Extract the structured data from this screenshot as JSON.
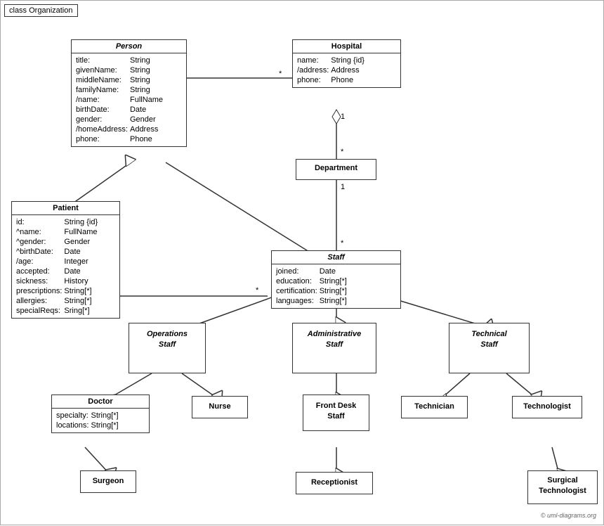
{
  "diagram": {
    "title": "class Organization",
    "copyright": "© uml-diagrams.org",
    "classes": {
      "person": {
        "name": "Person",
        "italic": true,
        "attrs": [
          {
            "name": "title:",
            "type": "String"
          },
          {
            "name": "givenName:",
            "type": "String"
          },
          {
            "name": "middleName:",
            "type": "String"
          },
          {
            "name": "familyName:",
            "type": "String"
          },
          {
            "name": "/name:",
            "type": "FullName"
          },
          {
            "name": "birthDate:",
            "type": "Date"
          },
          {
            "name": "gender:",
            "type": "Gender"
          },
          {
            "name": "/homeAddress:",
            "type": "Address"
          },
          {
            "name": "phone:",
            "type": "Phone"
          }
        ]
      },
      "hospital": {
        "name": "Hospital",
        "italic": false,
        "attrs": [
          {
            "name": "name:",
            "type": "String {id}"
          },
          {
            "name": "/address:",
            "type": "Address"
          },
          {
            "name": "phone:",
            "type": "Phone"
          }
        ]
      },
      "department": {
        "name": "Department",
        "italic": false,
        "attrs": []
      },
      "staff": {
        "name": "Staff",
        "italic": true,
        "attrs": [
          {
            "name": "joined:",
            "type": "Date"
          },
          {
            "name": "education:",
            "type": "String[*]"
          },
          {
            "name": "certification:",
            "type": "String[*]"
          },
          {
            "name": "languages:",
            "type": "String[*]"
          }
        ]
      },
      "patient": {
        "name": "Patient",
        "italic": false,
        "attrs": [
          {
            "name": "id:",
            "type": "String {id}"
          },
          {
            "name": "^name:",
            "type": "FullName"
          },
          {
            "name": "^gender:",
            "type": "Gender"
          },
          {
            "name": "^birthDate:",
            "type": "Date"
          },
          {
            "name": "/age:",
            "type": "Integer"
          },
          {
            "name": "accepted:",
            "type": "Date"
          },
          {
            "name": "sickness:",
            "type": "History"
          },
          {
            "name": "prescriptions:",
            "type": "String[*]"
          },
          {
            "name": "allergies:",
            "type": "String[*]"
          },
          {
            "name": "specialReqs:",
            "type": "Sring[*]"
          }
        ]
      },
      "operations_staff": {
        "name": "Operations\nStaff",
        "italic": true,
        "attrs": []
      },
      "administrative_staff": {
        "name": "Administrative\nStaff",
        "italic": true,
        "attrs": []
      },
      "technical_staff": {
        "name": "Technical\nStaff",
        "italic": true,
        "attrs": []
      },
      "doctor": {
        "name": "Doctor",
        "italic": false,
        "attrs": [
          {
            "name": "specialty:",
            "type": "String[*]"
          },
          {
            "name": "locations:",
            "type": "String[*]"
          }
        ]
      },
      "nurse": {
        "name": "Nurse",
        "italic": false,
        "attrs": []
      },
      "front_desk_staff": {
        "name": "Front Desk\nStaff",
        "italic": false,
        "attrs": []
      },
      "technician": {
        "name": "Technician",
        "italic": false,
        "attrs": []
      },
      "technologist": {
        "name": "Technologist",
        "italic": false,
        "attrs": []
      },
      "surgeon": {
        "name": "Surgeon",
        "italic": false,
        "attrs": []
      },
      "receptionist": {
        "name": "Receptionist",
        "italic": false,
        "attrs": []
      },
      "surgical_technologist": {
        "name": "Surgical\nTechnologist",
        "italic": false,
        "attrs": []
      }
    }
  }
}
